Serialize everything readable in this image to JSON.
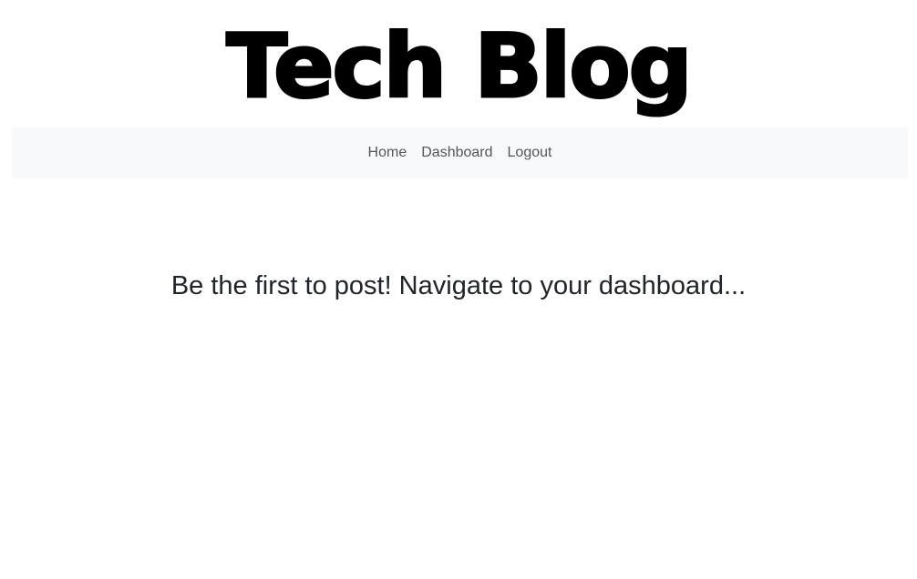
{
  "header": {
    "title": "Tech Blog"
  },
  "nav": {
    "items": [
      {
        "label": "Home"
      },
      {
        "label": "Dashboard"
      },
      {
        "label": "Logout"
      }
    ]
  },
  "main": {
    "empty_message": "Be the first to post! Navigate to your dashboard..."
  },
  "colors": {
    "navbar_background": "#f8f9fa",
    "nav_link": "#555555",
    "heading_text": "#212529",
    "title_text": "#000000"
  }
}
